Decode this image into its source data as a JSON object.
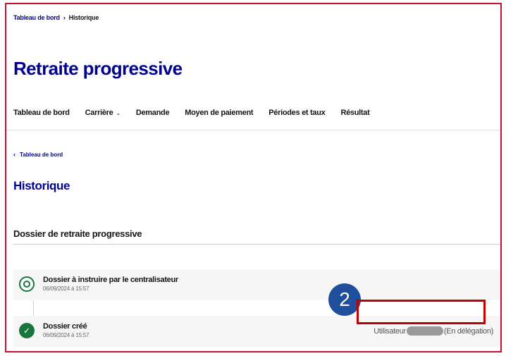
{
  "breadcrumb": {
    "items": [
      "Tableau de bord",
      "Historique"
    ],
    "separator": "›"
  },
  "page": {
    "title": "Retraite progressive"
  },
  "nav": {
    "items": [
      {
        "label": "Tableau de bord"
      },
      {
        "label": "Carrière",
        "has_dropdown": true
      },
      {
        "label": "Demande"
      },
      {
        "label": "Moyen de paiement"
      },
      {
        "label": "Périodes et taux"
      },
      {
        "label": "Résultat"
      }
    ],
    "chevron": "⌄"
  },
  "back_link": {
    "icon": "‹",
    "label": "Tableau de bord"
  },
  "section": {
    "title": "Historique"
  },
  "dossier": {
    "title": "Dossier de retraite progressive"
  },
  "timeline": {
    "events": [
      {
        "label": "Dossier à instruire par le centralisateur",
        "date": "06/09/2024 à 15:57",
        "status": "pending",
        "icon": "pending-circle-icon"
      },
      {
        "label": "Dossier créé",
        "date": "06/09/2024 à 15:57",
        "status": "done",
        "icon": "check-circle-icon",
        "user_prefix": "Utilisateur",
        "user_suffix": "(En délégation)"
      }
    ],
    "check_glyph": "✓"
  },
  "annotation": {
    "number": "2"
  },
  "colors": {
    "primary": "#000091",
    "success": "#18753c",
    "highlight": "#c00000",
    "badge": "#1f4e9c"
  }
}
